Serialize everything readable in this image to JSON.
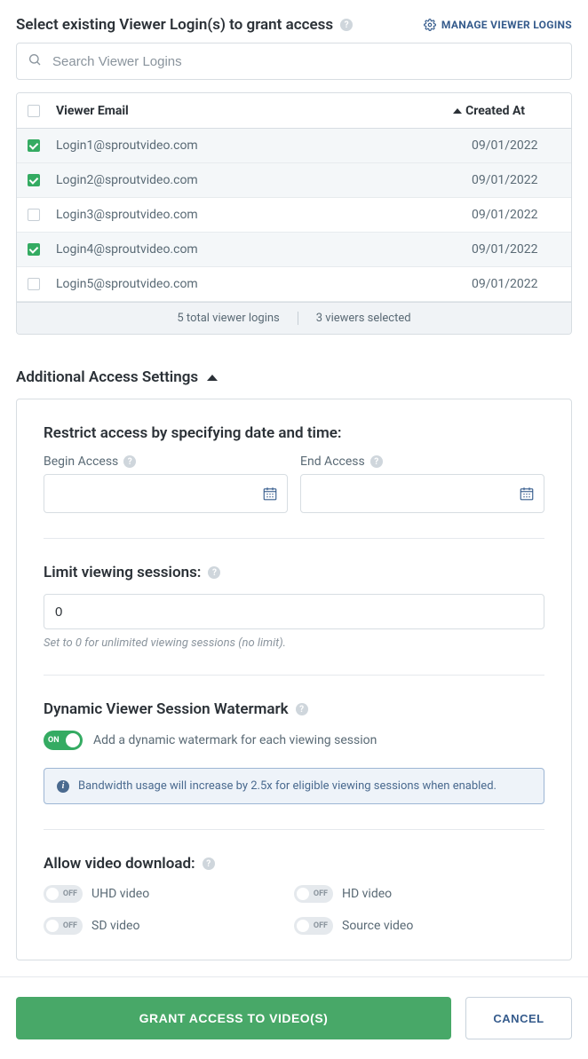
{
  "header": {
    "title": "Select existing Viewer Login(s) to grant access",
    "manage_link": "MANAGE VIEWER LOGINS"
  },
  "search": {
    "placeholder": "Search Viewer Logins"
  },
  "table": {
    "header_email": "Viewer Email",
    "header_created": "Created At",
    "rows": [
      {
        "email": "Login1@sproutvideo.com",
        "date": "09/01/2022",
        "checked": true
      },
      {
        "email": "Login2@sproutvideo.com",
        "date": "09/01/2022",
        "checked": true
      },
      {
        "email": "Login3@sproutvideo.com",
        "date": "09/01/2022",
        "checked": false
      },
      {
        "email": "Login4@sproutvideo.com",
        "date": "09/01/2022",
        "checked": true
      },
      {
        "email": "Login5@sproutvideo.com",
        "date": "09/01/2022",
        "checked": false
      }
    ],
    "footer_total": "5 total viewer logins",
    "footer_selected": "3 viewers selected"
  },
  "additional": {
    "heading": "Additional Access Settings",
    "restrict_heading": "Restrict access by specifying date and time:",
    "begin_label": "Begin Access",
    "end_label": "End Access",
    "limit_heading": "Limit viewing sessions:",
    "limit_value": "0",
    "limit_hint": "Set to 0 for unlimited viewing sessions (no limit).",
    "watermark_heading": "Dynamic Viewer Session Watermark",
    "watermark_toggle_label": "ON",
    "watermark_text": "Add a dynamic watermark for each viewing session",
    "info_text": "Bandwidth usage will increase by 2.5x for eligible viewing sessions when enabled.",
    "download_heading": "Allow video download:",
    "download_options": {
      "uhd": "UHD video",
      "hd": "HD video",
      "sd": "SD video",
      "source": "Source video"
    },
    "off_label": "OFF"
  },
  "footer": {
    "primary": "GRANT ACCESS TO VIDEO(S)",
    "secondary": "CANCEL"
  }
}
